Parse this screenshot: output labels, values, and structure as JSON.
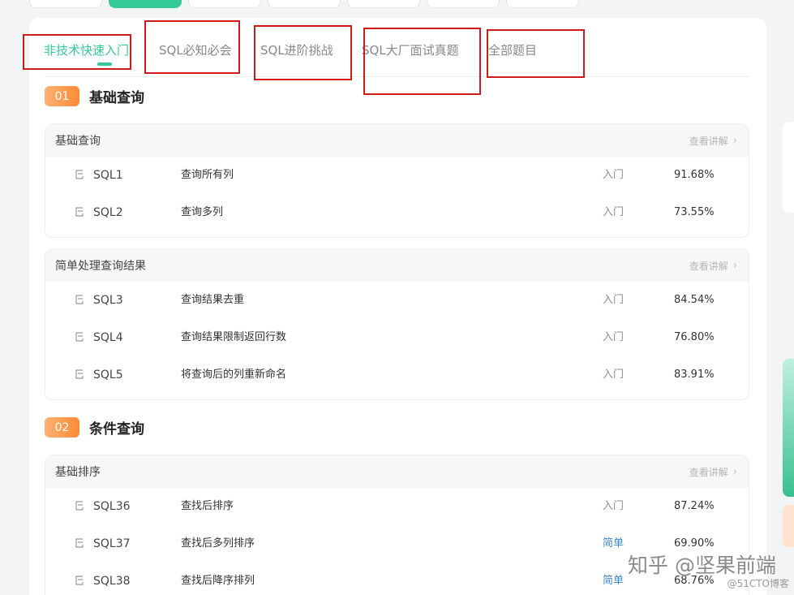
{
  "tabs": [
    {
      "label": "非技术快速入门",
      "active": true
    },
    {
      "label": "SQL必知必会",
      "active": false
    },
    {
      "label": "SQL进阶挑战",
      "active": false
    },
    {
      "label": "SQL大厂面试真题",
      "active": false
    },
    {
      "label": "全部题目",
      "active": false
    }
  ],
  "sections": [
    {
      "number": "01",
      "title": "基础查询",
      "groups": [
        {
          "title": "基础查询",
          "link": "查看讲解",
          "rows": [
            {
              "id": "SQL1",
              "name": "查询所有列",
              "level": "入门",
              "rate": "91.68%"
            },
            {
              "id": "SQL2",
              "name": "查询多列",
              "level": "入门",
              "rate": "73.55%"
            }
          ]
        },
        {
          "title": "简单处理查询结果",
          "link": "查看讲解",
          "rows": [
            {
              "id": "SQL3",
              "name": "查询结果去重",
              "level": "入门",
              "rate": "84.54%"
            },
            {
              "id": "SQL4",
              "name": "查询结果限制返回行数",
              "level": "入门",
              "rate": "76.80%"
            },
            {
              "id": "SQL5",
              "name": "将查询后的列重新命名",
              "level": "入门",
              "rate": "83.91%"
            }
          ]
        }
      ]
    },
    {
      "number": "02",
      "title": "条件查询",
      "groups": [
        {
          "title": "基础排序",
          "link": "查看讲解",
          "rows": [
            {
              "id": "SQL36",
              "name": "查找后排序",
              "level": "入门",
              "rate": "87.24%"
            },
            {
              "id": "SQL37",
              "name": "查找后多列排序",
              "level": "简单",
              "rate": "69.90%"
            },
            {
              "id": "SQL38",
              "name": "查找后降序排列",
              "level": "简单",
              "rate": "68.76%"
            }
          ]
        }
      ]
    }
  ],
  "watermark": "知乎 @坚果前端",
  "watermark_small": "@51CTO博客",
  "colors": {
    "accent": "#32ca99",
    "badge": "#ff8a35",
    "highlight_box": "#d11a1a",
    "level_easy": "#3a8bd6"
  },
  "icons": {
    "problem": "document-edit-icon",
    "more": "chevron-right-icon"
  }
}
